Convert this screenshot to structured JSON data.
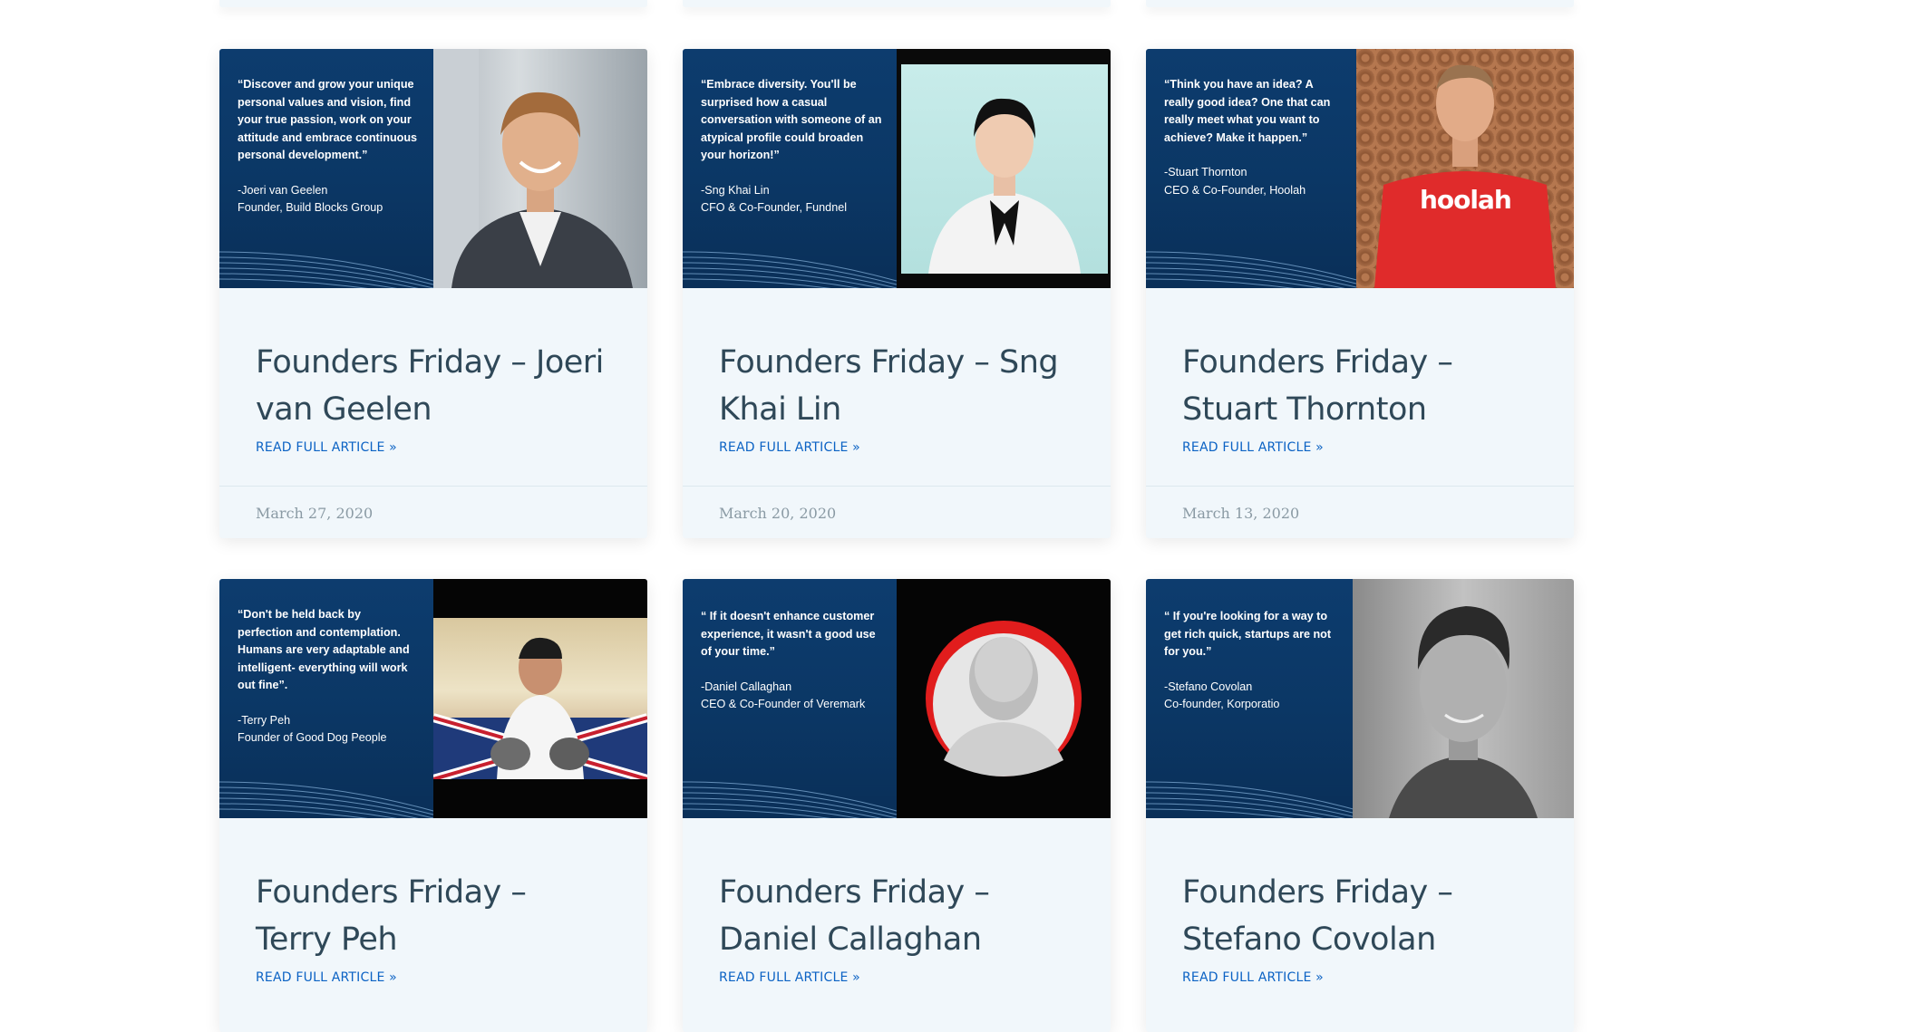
{
  "posts": [
    {
      "title": "Founders Friday – Joeri van Geelen",
      "link": "READ FULL ARTICLE »",
      "date": "March 27, 2020",
      "quote": "“Discover and grow your unique personal values and vision, find your true passion, work on your attitude and embrace continuous personal development.”",
      "attribution": "-Joeri van Geelen\nFounder, Build Blocks Group",
      "photo_logo": ""
    },
    {
      "title": "Founders Friday – Sng Khai Lin",
      "link": "READ FULL ARTICLE »",
      "date": "March 20, 2020",
      "quote": "“Embrace diversity. You'll be surprised how a casual conversation with someone of an atypical profile could broaden your horizon!”",
      "attribution": "-Sng Khai Lin\nCFO & Co-Founder, Fundnel",
      "photo_logo": ""
    },
    {
      "title": "Founders Friday – Stuart Thornton",
      "link": "READ FULL ARTICLE »",
      "date": "March 13, 2020",
      "quote": "“Think you have an idea? A really good idea? One that can really meet what you want to achieve? Make it happen.”",
      "attribution": "-Stuart Thornton\nCEO & Co-Founder, Hoolah",
      "photo_logo": "hoolah"
    },
    {
      "title": "Founders Friday – Terry Peh",
      "link": "READ FULL ARTICLE »",
      "date": "",
      "quote": "“Don't be held back by perfection and contemplation. Humans are very adaptable and intelligent- everything will work out fine”.",
      "attribution": "-Terry Peh\nFounder of Good Dog People",
      "photo_logo": ""
    },
    {
      "title": "Founders Friday – Daniel Callaghan",
      "link": "READ FULL ARTICLE »",
      "date": "",
      "quote": "“ If it doesn't enhance customer experience, it wasn't a good use of your time.”",
      "attribution": "-Daniel Callaghan\nCEO & Co-Founder of Veremark",
      "photo_logo": ""
    },
    {
      "title": "Founders Friday – Stefano Covolan",
      "link": "READ FULL ARTICLE »",
      "date": "",
      "quote": "“ If you're looking for a way to get rich quick, startups are not for you.”",
      "attribution": "-Stefano Covolan\nCo-founder, Korporatio",
      "photo_logo": ""
    }
  ],
  "colors": {
    "card_bg": "#f1f7fb",
    "title": "#2f4858",
    "link": "#0b62c4",
    "date": "#8a9aa4",
    "quote_panel": "#0d3c6e"
  }
}
